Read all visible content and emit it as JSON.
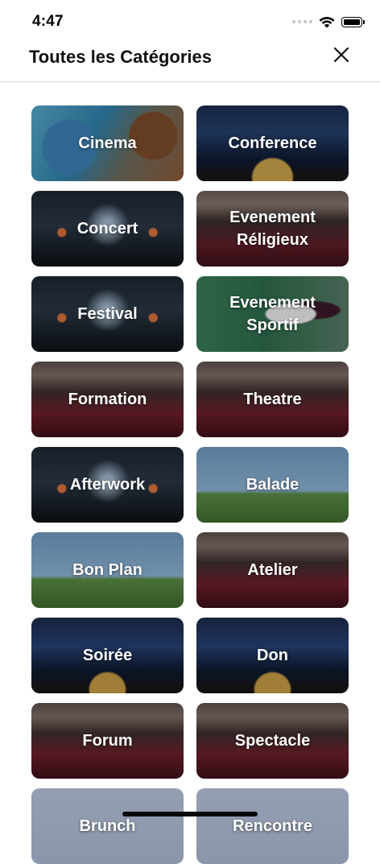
{
  "status_bar": {
    "time": "4:47"
  },
  "header": {
    "title": "Toutes les Catégories",
    "close_icon": "close-icon"
  },
  "categories": [
    {
      "label": "Cinema",
      "bg": "bg-cinema"
    },
    {
      "label": "Conference",
      "bg": "bg-conference"
    },
    {
      "label": "Concert",
      "bg": "bg-concert"
    },
    {
      "label": "Evenement Réligieux",
      "bg": "bg-religieux"
    },
    {
      "label": "Festival",
      "bg": "bg-concert"
    },
    {
      "label": "Evenement Sportif",
      "bg": "bg-sportif"
    },
    {
      "label": "Formation",
      "bg": "bg-theatre"
    },
    {
      "label": "Theatre",
      "bg": "bg-theatre"
    },
    {
      "label": "Afterwork",
      "bg": "bg-concert"
    },
    {
      "label": "Balade",
      "bg": "bg-balade"
    },
    {
      "label": "Bon Plan",
      "bg": "bg-balade"
    },
    {
      "label": "Atelier",
      "bg": "bg-theatre"
    },
    {
      "label": "Soirée",
      "bg": "bg-soiree"
    },
    {
      "label": "Don",
      "bg": "bg-soiree"
    },
    {
      "label": "Forum",
      "bg": "bg-theatre"
    },
    {
      "label": "Spectacle",
      "bg": "bg-theatre"
    },
    {
      "label": "Brunch",
      "bg": "bg-faded"
    },
    {
      "label": "Rencontre",
      "bg": "bg-faded"
    }
  ],
  "colors": {
    "label_text": "#ffffff",
    "divider": "#d9d9d9"
  }
}
